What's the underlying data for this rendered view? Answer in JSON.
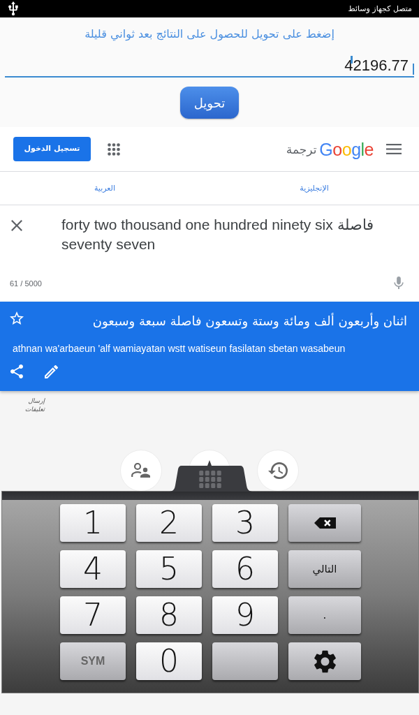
{
  "status_bar": {
    "notification": "متصل كجهاز وسائط"
  },
  "converter": {
    "hint": "إضغط على تحويل للحصول على النتائج بعد ثواني قليلة",
    "input": {
      "value": "42196.77"
    },
    "button": "تحويل"
  },
  "translate": {
    "header": {
      "logo": "Google",
      "product": "ترجمة",
      "sign_in": "تسجيل الدخول"
    },
    "languages": [
      {
        "label": "الإنجليزية"
      },
      {
        "label": "العربية"
      }
    ],
    "source": {
      "text": "forty two thousand one hundred ninety six فاصلة seventy seven",
      "counter": "61 / 5000"
    },
    "result": {
      "text": "اثنان وأربعون ألف ومائة وستة وتسعون فاصلة سبعة وسبعون",
      "transliteration": "athnan wa'arbaeun 'alf wamiayatan wstt watiseun fasilatan sbetan wasabeun"
    },
    "feedback": "إرسال تعليقات"
  },
  "keyboard": {
    "rows": [
      [
        {
          "kind": "backspace"
        },
        {
          "kind": "digit",
          "label": "3"
        },
        {
          "kind": "digit",
          "label": "2"
        },
        {
          "kind": "digit",
          "label": "1"
        }
      ],
      [
        {
          "kind": "text",
          "label": "التالي"
        },
        {
          "kind": "digit",
          "label": "6"
        },
        {
          "kind": "digit",
          "label": "5"
        },
        {
          "kind": "digit",
          "label": "4"
        }
      ],
      [
        {
          "kind": "text",
          "label": "."
        },
        {
          "kind": "digit",
          "label": "9"
        },
        {
          "kind": "digit",
          "label": "8"
        },
        {
          "kind": "digit",
          "label": "7"
        }
      ],
      [
        {
          "kind": "settings"
        },
        {
          "kind": "blank"
        },
        {
          "kind": "digit",
          "label": "0"
        },
        {
          "kind": "mode",
          "label": "SYM"
        }
      ]
    ]
  }
}
